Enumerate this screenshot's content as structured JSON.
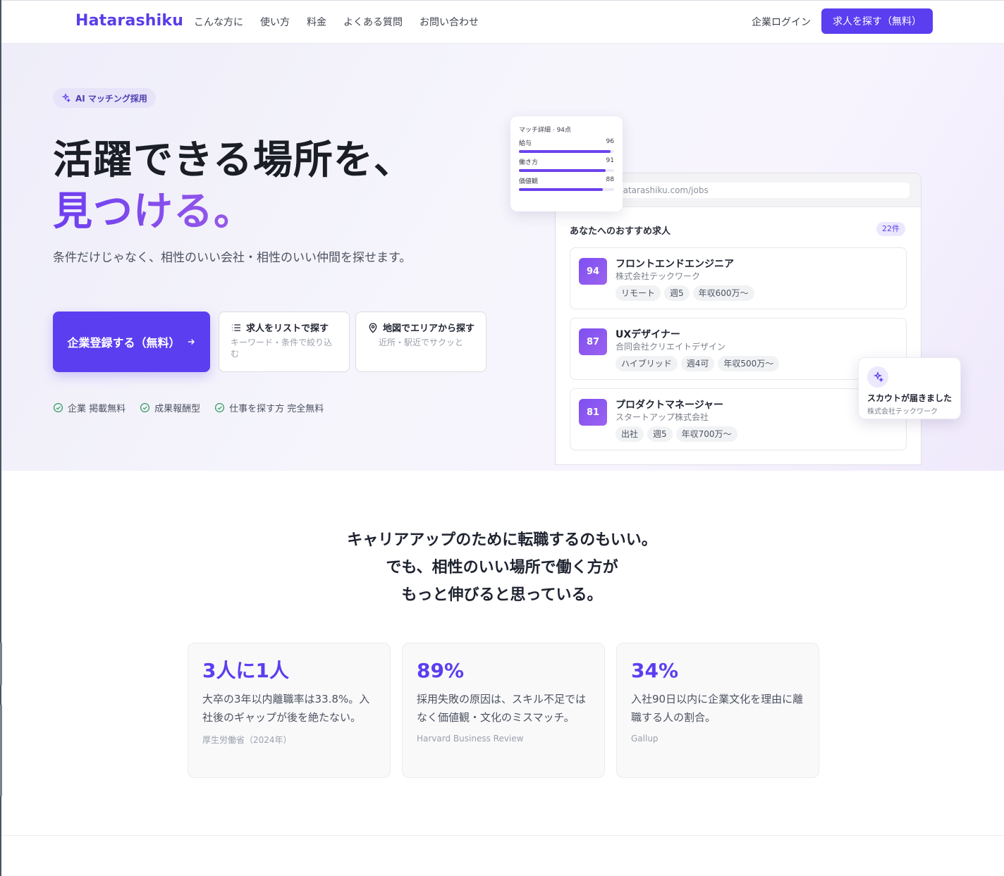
{
  "header": {
    "logo": "Hatarashiku",
    "nav": [
      "こんな方に",
      "使い方",
      "料金",
      "よくある質問",
      "お問い合わせ"
    ],
    "login": "企業ログイン",
    "cta": "求人を探す（無料）"
  },
  "hero": {
    "badge": "AI マッチング採用",
    "title_line1": "活躍できる場所を、",
    "title_line2": "見つける。",
    "lead": "条件だけじゃなく、相性のいい会社・相性のいい仲間を探せます。",
    "primary_button": "企業登録する（無料）",
    "list_button": {
      "title": "求人をリストで探す",
      "sub": "キーワード・条件で絞り込む"
    },
    "map_button": {
      "title": "地図でエリアから探す",
      "sub": "近所・駅近でサクッと"
    },
    "checks": [
      "企業 掲載無料",
      "成果報酬型",
      "仕事を探す方 完全無料"
    ]
  },
  "mock": {
    "url": "hatarashiku.com/jobs",
    "rec_title": "あなたへのおすすめ求人",
    "rec_count": "22件",
    "jobs": [
      {
        "score": "94",
        "title": "フロントエンドエンジニア",
        "company": "株式会社テックワーク",
        "tags": [
          "リモート",
          "週5",
          "年収600万〜"
        ]
      },
      {
        "score": "87",
        "title": "UXデザイナー",
        "company": "合同会社クリエイトデザイン",
        "tags": [
          "ハイブリッド",
          "週4可",
          "年収500万〜"
        ]
      },
      {
        "score": "81",
        "title": "プロダクトマネージャー",
        "company": "スタートアップ株式会社",
        "tags": [
          "出社",
          "週5",
          "年収700万〜"
        ]
      }
    ],
    "match": {
      "title": "マッチ詳細 · 94点",
      "rows": [
        {
          "label": "給与",
          "value": "96",
          "level": 0.96
        },
        {
          "label": "働き方",
          "value": "91",
          "level": 0.91
        },
        {
          "label": "価値観",
          "value": "88",
          "level": 0.88
        }
      ]
    },
    "scout": {
      "title": "スカウトが届きました",
      "company": "株式会社テックワーク"
    }
  },
  "message": {
    "line1": "キャリアアップのために転職するのもいい。",
    "line2": "でも、相性のいい場所で働く方が",
    "line3": "もっと伸びると思っている。"
  },
  "stats": [
    {
      "num": "3人に1人",
      "desc": "大卒の3年以内離職率は33.8%。入社後のギャップが後を絶たない。",
      "src": "厚生労働省（2024年）"
    },
    {
      "num": "89%",
      "desc": "採用失敗の原因は、スキル不足ではなく価値観・文化のミスマッチ。",
      "src": "Harvard Business Review"
    },
    {
      "num": "34%",
      "desc": "入社90日以内に企業文化を理由に離職する人の割合。",
      "src": "Gallup"
    }
  ],
  "colors": {
    "accent": "#5b3ef0",
    "accent_light": "#ebe8fd",
    "check": "#3fa26a"
  }
}
